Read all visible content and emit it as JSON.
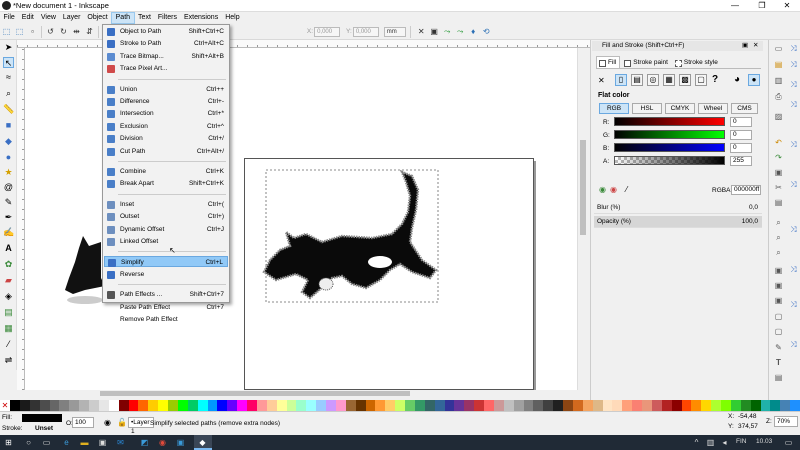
{
  "window": {
    "title": "*New document 1 - Inkscape",
    "minimize": "—",
    "maximize": "❐",
    "close": "✕"
  },
  "menubar": [
    "File",
    "Edit",
    "View",
    "Layer",
    "Object",
    "Path",
    "Text",
    "Filters",
    "Extensions",
    "Help"
  ],
  "coords": {
    "x_label": "X:",
    "x_value": "0,000",
    "y_label": "Y:",
    "y_value": "0,000",
    "unit": "mm"
  },
  "path_menu": [
    {
      "label": "Object to Path",
      "shortcut": "Shift+Ctrl+C",
      "icon": "object-to-path-icon",
      "color": "#3a6fc4"
    },
    {
      "label": "Stroke to Path",
      "shortcut": "Ctrl+Alt+C",
      "icon": "stroke-to-path-icon",
      "color": "#3a6fc4"
    },
    {
      "label": "Trace Bitmap...",
      "shortcut": "Shift+Alt+B",
      "icon": "trace-bitmap-icon",
      "color": "#5b8bd0"
    },
    {
      "label": "Trace Pixel Art...",
      "shortcut": "",
      "icon": "trace-pixel-art-icon",
      "color": "#d04a4a"
    },
    {
      "label": "Union",
      "shortcut": "Ctrl++",
      "icon": "union-icon",
      "color": "#4a7fc8"
    },
    {
      "label": "Difference",
      "shortcut": "Ctrl+-",
      "icon": "difference-icon",
      "color": "#4a7fc8"
    },
    {
      "label": "Intersection",
      "shortcut": "Ctrl+*",
      "icon": "intersection-icon",
      "color": "#4a7fc8"
    },
    {
      "label": "Exclusion",
      "shortcut": "Ctrl+^",
      "icon": "exclusion-icon",
      "color": "#4a7fc8"
    },
    {
      "label": "Division",
      "shortcut": "Ctrl+/",
      "icon": "division-icon",
      "color": "#4a7fc8"
    },
    {
      "label": "Cut Path",
      "shortcut": "Ctrl+Alt+/",
      "icon": "cut-path-icon",
      "color": "#4a7fc8"
    },
    {
      "label": "Combine",
      "shortcut": "Ctrl+K",
      "icon": "combine-icon",
      "color": "#4a7fc8"
    },
    {
      "label": "Break Apart",
      "shortcut": "Shift+Ctrl+K",
      "icon": "break-apart-icon",
      "color": "#4a7fc8"
    },
    {
      "label": "Inset",
      "shortcut": "Ctrl+(",
      "icon": "inset-icon",
      "color": "#6d8fbf"
    },
    {
      "label": "Outset",
      "shortcut": "Ctrl+)",
      "icon": "outset-icon",
      "color": "#6d8fbf"
    },
    {
      "label": "Dynamic Offset",
      "shortcut": "Ctrl+J",
      "icon": "dynamic-offset-icon",
      "color": "#6d8fbf"
    },
    {
      "label": "Linked Offset",
      "shortcut": "",
      "icon": "linked-offset-icon",
      "color": "#6d8fbf"
    },
    {
      "label": "Simplify",
      "shortcut": "Ctrl+L",
      "icon": "simplify-icon",
      "color": "#3a6fc4"
    },
    {
      "label": "Reverse",
      "shortcut": "",
      "icon": "reverse-icon",
      "color": "#3a6fc4"
    },
    {
      "label": "Path Effects ...",
      "shortcut": "Shift+Ctrl+7",
      "icon": "path-effects-icon",
      "color": "#555"
    },
    {
      "label": "Paste Path Effect",
      "shortcut": "Ctrl+7",
      "icon": "",
      "color": ""
    },
    {
      "label": "Remove Path Effect",
      "shortcut": "",
      "icon": "",
      "color": ""
    }
  ],
  "dock": {
    "title": "Fill and Stroke (Shift+Ctrl+F)",
    "tabs": [
      "Fill",
      "Stroke paint",
      "Stroke style"
    ],
    "mode_label": "Flat color",
    "color_modes": [
      "RGB",
      "HSL",
      "CMYK",
      "Wheel",
      "CMS"
    ],
    "channels": [
      {
        "label": "R:",
        "value": "0",
        "color": "#ff0000"
      },
      {
        "label": "G:",
        "value": "0",
        "color": "#00ff00"
      },
      {
        "label": "B:",
        "value": "0",
        "color": "#0000ff"
      },
      {
        "label": "A:",
        "value": "255",
        "color": "#000000"
      }
    ],
    "rgba_label": "RGBA:",
    "rgba_value": "000000ff",
    "blur_label": "Blur (%)",
    "blur_value": "0,0",
    "opacity_label": "Opacity (%)",
    "opacity_value": "100,0"
  },
  "status": {
    "fill_label": "Fill:",
    "stroke_label": "Stroke:",
    "stroke_value": "Unset",
    "opacity_label": "O:",
    "opacity_value": "100",
    "layer": "•Layer 1",
    "message": "Simplify selected paths (remove extra nodes)",
    "x_label": "X:",
    "x_value": "-54,48",
    "y_label": "Y:",
    "y_value": "374,57",
    "zoom_label": "Z:",
    "zoom_value": "70%"
  },
  "taskbar": {
    "lang": "FIN",
    "time": "10.03"
  },
  "palette": [
    "#000000",
    "#1a1a1a",
    "#333",
    "#4d4d4d",
    "#666",
    "#808080",
    "#999",
    "#b3b3b3",
    "#ccc",
    "#e6e6e6",
    "#fff",
    "#800000",
    "#ff0000",
    "#ff6600",
    "#ffcc00",
    "#ffff00",
    "#99cc00",
    "#00ff00",
    "#00cc66",
    "#00ffff",
    "#0099ff",
    "#0000ff",
    "#6600ff",
    "#ff00ff",
    "#ff0066",
    "#ff9999",
    "#ffcc99",
    "#ffff99",
    "#ccff99",
    "#99ffcc",
    "#99ffff",
    "#99ccff",
    "#cc99ff",
    "#ff99cc",
    "#996633",
    "#663300",
    "#cc6600",
    "#ff9933",
    "#ffcc66",
    "#ccff66",
    "#66cc66",
    "#339966",
    "#336666",
    "#336699",
    "#333399",
    "#663399",
    "#993366",
    "#cc3333",
    "#ff6666",
    "#cc9999",
    "#c0c0c0",
    "#a0a0a0",
    "#808080",
    "#606060",
    "#404040",
    "#202020",
    "#8b4513",
    "#d2691e",
    "#f4a460",
    "#deb887",
    "#ffe4c4",
    "#ffdab9",
    "#ffa07a",
    "#fa8072",
    "#e9967a",
    "#cd5c5c",
    "#b22222",
    "#8b0000",
    "#ff4500",
    "#ff8c00",
    "#ffd700",
    "#adff2f",
    "#7fff00",
    "#32cd32",
    "#228b22",
    "#006400",
    "#20b2aa",
    "#008b8b",
    "#4682b4",
    "#1e90ff"
  ]
}
